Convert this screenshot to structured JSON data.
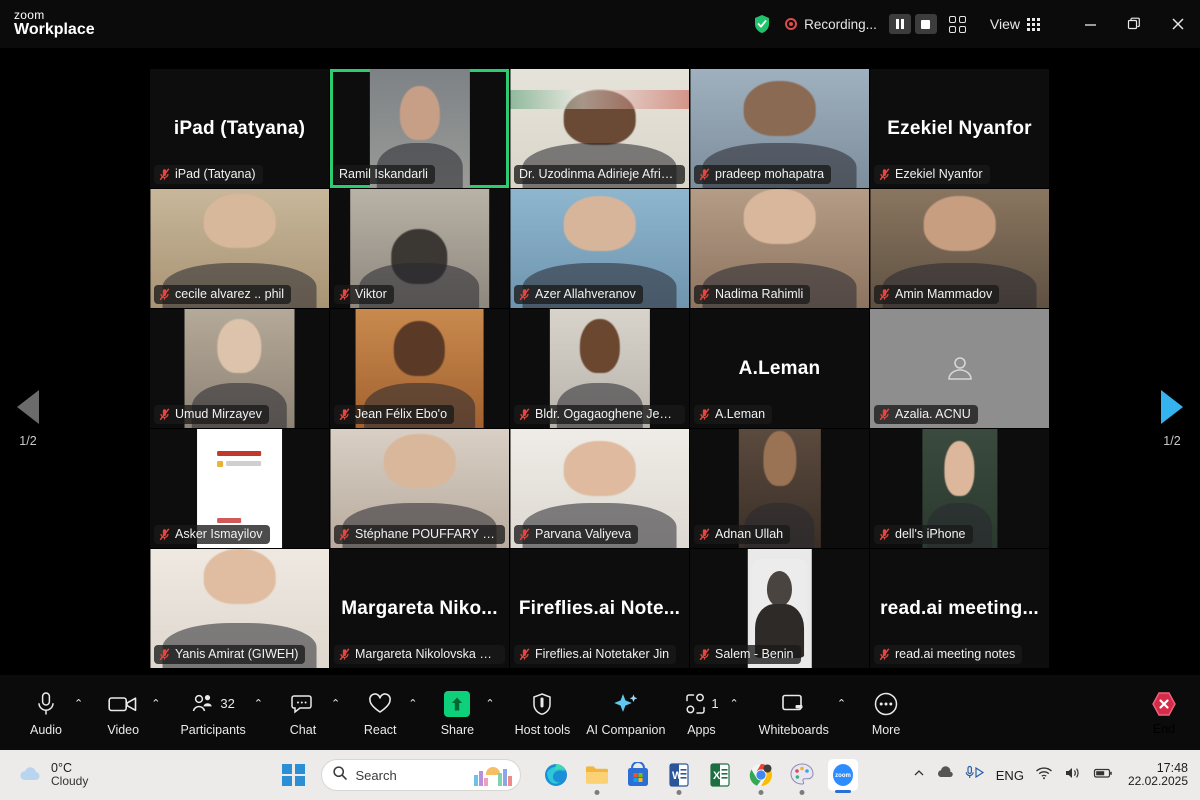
{
  "titlebar": {
    "brand_top": "zoom",
    "brand_bottom": "Workplace",
    "shield_icon": "shield-check-icon",
    "recording_label": "Recording...",
    "pause_recording_icon": "pause-icon",
    "stop_recording_icon": "stop-icon",
    "layout_icon": "grid-layout-icon",
    "view_label": "View",
    "view_icon": "view-grid-icon",
    "minimize_icon": "minimize-icon",
    "restore_icon": "restore-icon",
    "close_icon": "close-icon"
  },
  "pager": {
    "left_label": "1/2",
    "right_label": "1/2",
    "left_icon": "chevron-left-icon",
    "right_icon": "chevron-right-icon"
  },
  "grid": {
    "rows": [
      {
        "participants": [
          {
            "name": "iPad (Tatyana)",
            "display": "big-name",
            "big_label": "iPad (Tatyana)",
            "muted": true,
            "active": false
          },
          {
            "name": "Ramil Iskandarli",
            "display": "video",
            "muted": false,
            "active": true
          },
          {
            "name": "Dr. Uzodinma Adirieje  Afriheal...",
            "display": "video",
            "muted": false,
            "active": false
          },
          {
            "name": "pradeep mohapatra",
            "display": "video",
            "muted": true,
            "active": false
          },
          {
            "name": "Ezekiel Nyanfor",
            "display": "big-name",
            "big_label": "Ezekiel Nyanfor",
            "muted": true,
            "active": false
          }
        ]
      },
      {
        "participants": [
          {
            "name": "cecile alvarez .. phil",
            "display": "video",
            "muted": true,
            "active": false
          },
          {
            "name": "Viktor",
            "display": "video",
            "muted": true,
            "active": false
          },
          {
            "name": "Azer Allahveranov",
            "display": "video",
            "muted": true,
            "active": false
          },
          {
            "name": "Nadima Rahimli",
            "display": "video",
            "muted": true,
            "active": false
          },
          {
            "name": "Amin Mammadov",
            "display": "video",
            "muted": true,
            "active": false
          }
        ]
      },
      {
        "participants": [
          {
            "name": "Umud Mirzayev",
            "display": "video",
            "muted": true,
            "active": false
          },
          {
            "name": "Jean Félix Ebo'o",
            "display": "video",
            "muted": true,
            "active": false
          },
          {
            "name": "Bldr. Ogagaoghene Jesse Iti...",
            "display": "video",
            "muted": true,
            "active": false
          },
          {
            "name": "A.Leman",
            "display": "big-name",
            "big_label": "A.Leman",
            "muted": true,
            "active": false
          },
          {
            "name": "Azalia. ACNU",
            "display": "avatar",
            "avatar_icon": "person-placeholder-icon",
            "muted": true,
            "active": false
          }
        ]
      },
      {
        "participants": [
          {
            "name": "Asker Ismayilov",
            "display": "video",
            "muted": true,
            "active": false
          },
          {
            "name": "Stéphane POUFFARY - ENER...",
            "display": "video",
            "muted": true,
            "active": false
          },
          {
            "name": "Parvana Valiyeva",
            "display": "video",
            "muted": true,
            "active": false
          },
          {
            "name": "Adnan Ullah",
            "display": "video",
            "muted": true,
            "active": false
          },
          {
            "name": "dell's iPhone",
            "display": "video",
            "muted": true,
            "active": false
          }
        ]
      },
      {
        "participants": [
          {
            "name": "Yanis Amirat (GIWEH)",
            "display": "video",
            "muted": true,
            "active": false
          },
          {
            "name": "Margareta Nikolovska ETF",
            "display": "big-name",
            "big_label": "Margareta  Niko...",
            "muted": true,
            "active": false
          },
          {
            "name": "Fireflies.ai Notetaker Jin",
            "display": "big-name",
            "big_label": "Fireflies.ai  Note...",
            "muted": true,
            "active": false
          },
          {
            "name": "Salem - Benin",
            "display": "video",
            "muted": true,
            "active": false
          },
          {
            "name": "read.ai meeting notes",
            "display": "big-name",
            "big_label": "read.ai  meeting...",
            "muted": true,
            "active": false
          }
        ]
      }
    ]
  },
  "toolbar": {
    "items": [
      {
        "label": "Audio",
        "icon": "microphone-icon",
        "caret": true,
        "count": ""
      },
      {
        "label": "Video",
        "icon": "camera-icon",
        "caret": true,
        "count": ""
      },
      {
        "label": "Participants",
        "icon": "participants-icon",
        "caret": true,
        "count": "32"
      },
      {
        "label": "Chat",
        "icon": "chat-bubble-icon",
        "caret": true,
        "count": ""
      },
      {
        "label": "React",
        "icon": "heart-icon",
        "caret": true,
        "count": ""
      },
      {
        "label": "Share",
        "icon": "share-screen-icon",
        "caret": true,
        "count": ""
      },
      {
        "label": "Host tools",
        "icon": "shield-icon",
        "caret": false,
        "count": ""
      },
      {
        "label": "AI Companion",
        "icon": "ai-sparkle-icon",
        "caret": false,
        "count": ""
      },
      {
        "label": "Apps",
        "icon": "apps-icon",
        "caret": true,
        "count": "1"
      },
      {
        "label": "Whiteboards",
        "icon": "whiteboard-icon",
        "caret": true,
        "count": ""
      },
      {
        "label": "More",
        "icon": "more-dots-icon",
        "caret": false,
        "count": ""
      }
    ],
    "end_label": "End",
    "end_icon": "end-call-icon"
  },
  "taskbar": {
    "weather": {
      "temperature": "0°C",
      "condition": "Cloudy",
      "icon": "cloud-icon"
    },
    "start_icon": "windows-start-icon",
    "search": {
      "placeholder": "Search",
      "icon": "search-icon",
      "art_icon": "search-highlight-art"
    },
    "apps": [
      {
        "name": "edge-icon",
        "running": false
      },
      {
        "name": "file-explorer-icon",
        "running": true
      },
      {
        "name": "microsoft-store-icon",
        "running": false
      },
      {
        "name": "word-icon",
        "running": true
      },
      {
        "name": "excel-icon",
        "running": false
      },
      {
        "name": "chrome-icon",
        "running": true
      },
      {
        "name": "paint-icon",
        "running": true
      },
      {
        "name": "zoom-icon",
        "running": true
      }
    ],
    "tray": {
      "overflow_icon": "chevron-up-icon",
      "onedrive_icon": "onedrive-icon",
      "mic_icon": "microphone-tray-icon",
      "language": "ENG",
      "wifi_icon": "wifi-icon",
      "volume_icon": "volume-icon",
      "battery_icon": "battery-icon",
      "time": "17:48",
      "date": "22.02.2025"
    }
  }
}
